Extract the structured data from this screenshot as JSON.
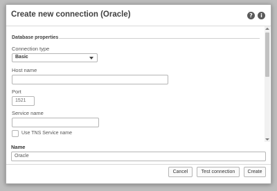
{
  "dialog": {
    "title": "Create new connection (Oracle)",
    "help_icon": "help-icon",
    "info_icon": "info-icon"
  },
  "database_properties": {
    "section_title": "Database properties",
    "connection_type": {
      "label": "Connection type",
      "value": "Basic"
    },
    "host_name": {
      "label": "Host name",
      "value": ""
    },
    "port": {
      "label": "Port",
      "value": "1521"
    },
    "service_name": {
      "label": "Service name",
      "value": ""
    },
    "use_tns": {
      "label": "Use TNS Service name",
      "checked": false
    }
  },
  "name": {
    "label": "Name",
    "value": "Oracle"
  },
  "footer": {
    "cancel_label": "Cancel",
    "test_label": "Test connection",
    "create_label": "Create"
  },
  "colors": {
    "background": "#bdbdbd",
    "dialog": "#ffffff",
    "text": "#404040"
  }
}
